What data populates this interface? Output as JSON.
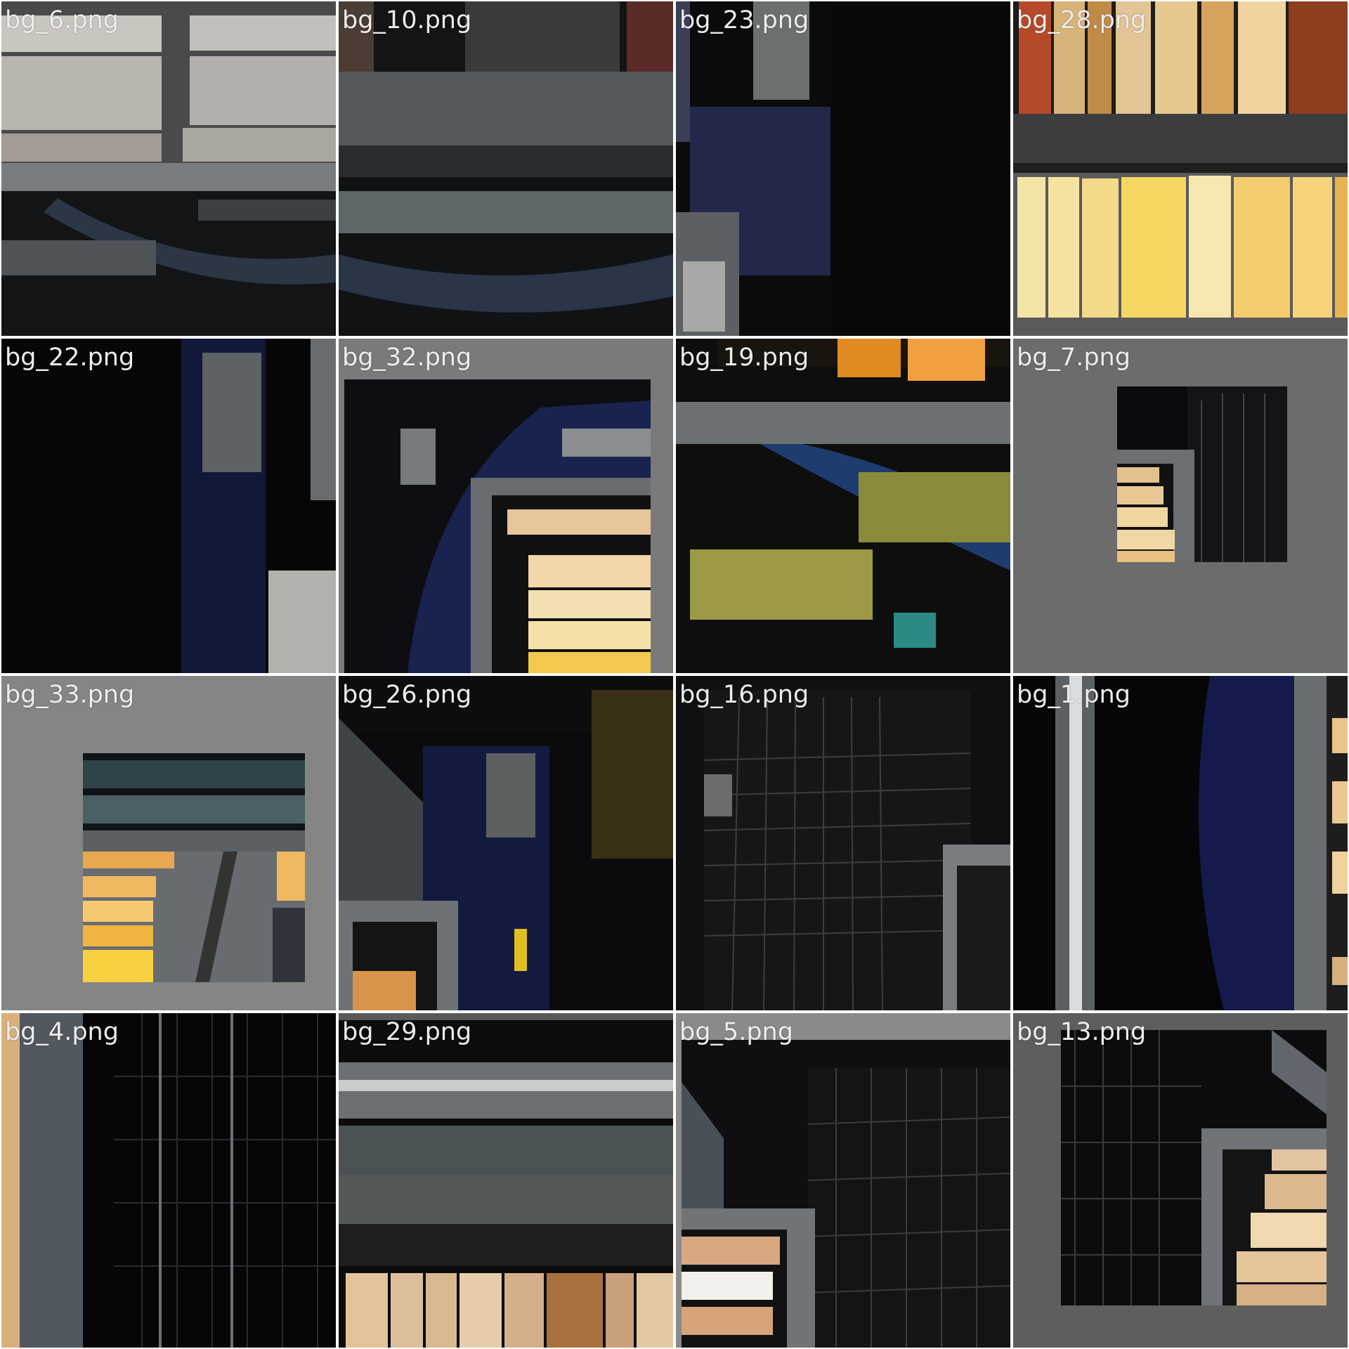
{
  "tiles": [
    {
      "label": "bg_6.png"
    },
    {
      "label": "bg_10.png"
    },
    {
      "label": "bg_23.png"
    },
    {
      "label": "bg_28.png"
    },
    {
      "label": "bg_22.png"
    },
    {
      "label": "bg_32.png"
    },
    {
      "label": "bg_19.png"
    },
    {
      "label": "bg_7.png"
    },
    {
      "label": "bg_33.png"
    },
    {
      "label": "bg_26.png"
    },
    {
      "label": "bg_16.png"
    },
    {
      "label": "bg_1.png"
    },
    {
      "label": "bg_4.png"
    },
    {
      "label": "bg_29.png"
    },
    {
      "label": "bg_5.png"
    },
    {
      "label": "bg_13.png"
    }
  ]
}
